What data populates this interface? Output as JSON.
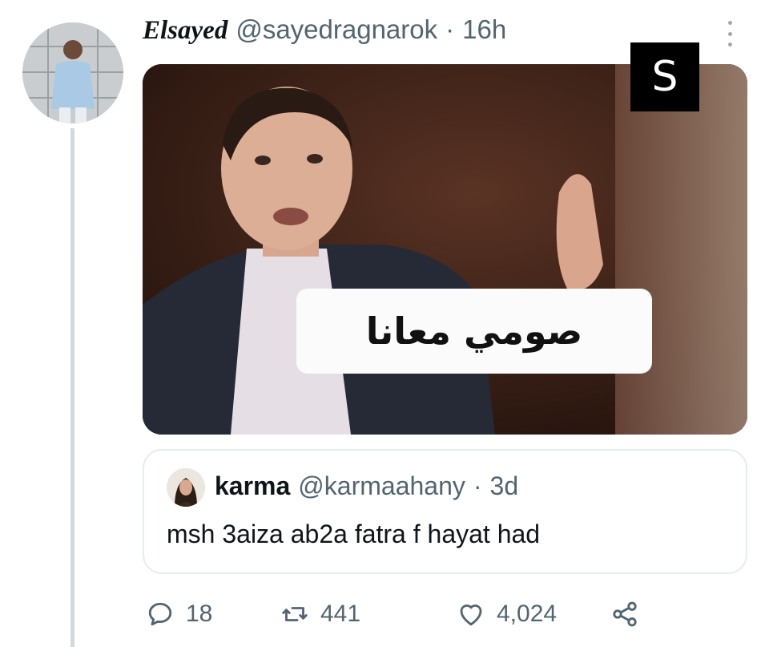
{
  "tweet": {
    "author": {
      "display_name": "Elsayed",
      "handle": "@sayedragnarok",
      "separator": "·",
      "time": "16h"
    },
    "media": {
      "caption": "صومي معانا",
      "brand_logo_text": "S"
    },
    "quoted_tweet": {
      "display_name": "karma",
      "handle": "@karmaahany",
      "separator": "·",
      "time": "3d",
      "text": "msh 3aiza ab2a fatra f hayat had"
    },
    "actions": {
      "replies": "18",
      "retweets": "441",
      "likes": "4,024"
    }
  },
  "icons": {
    "more": "more-vertical-icon",
    "reply": "reply-icon",
    "retweet": "retweet-icon",
    "like": "heart-icon",
    "share": "share-icon"
  },
  "colors": {
    "secondary_text": "#536471",
    "border": "#e6ecf0",
    "thread_line": "#cfd9de"
  }
}
